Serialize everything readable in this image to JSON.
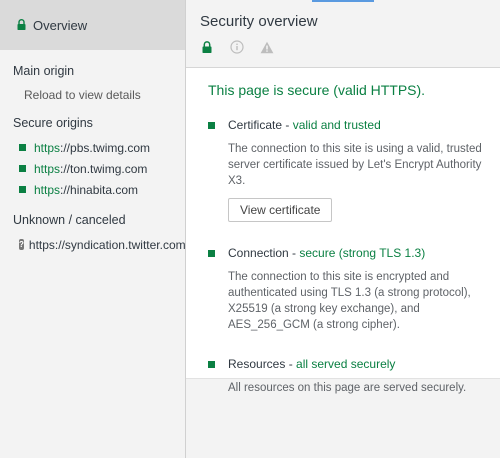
{
  "sidebar": {
    "overview_label": "Overview",
    "main_origin": {
      "heading": "Main origin",
      "note": "Reload to view details"
    },
    "secure_origins": {
      "heading": "Secure origins",
      "items": [
        {
          "scheme": "https",
          "host": "://pbs.twimg.com"
        },
        {
          "scheme": "https",
          "host": "://ton.twimg.com"
        },
        {
          "scheme": "https",
          "host": "://hinabita.com"
        }
      ]
    },
    "unknown_origins": {
      "heading": "Unknown / canceled",
      "items": [
        {
          "url": "https://syndication.twitter.com",
          "icon": "question-icon"
        }
      ]
    }
  },
  "main": {
    "title": "Security overview",
    "icons": [
      "lock-icon",
      "info-icon",
      "warning-icon"
    ],
    "summary": "This page is secure (valid HTTPS).",
    "sections": [
      {
        "title": "Certificate - ",
        "status": "valid and trusted",
        "description": "The connection to this site is using a valid, trusted server certificate issued by Let's Encrypt Authority X3.",
        "button": "View certificate"
      },
      {
        "title": "Connection - ",
        "status": "secure (strong TLS 1.3)",
        "description": "The connection to this site is encrypted and authenticated using TLS 1.3 (a strong protocol), X25519 (a strong key exchange), and AES_256_GCM (a strong cipher)."
      },
      {
        "title": "Resources - ",
        "status": "all served securely",
        "description": "All resources on this page are served securely."
      }
    ]
  },
  "colors": {
    "secure_green": "#0b8043",
    "sidebar_bg": "#f3f3f3",
    "selected_bg": "#dadada",
    "tab_accent": "#5a9ae0"
  }
}
